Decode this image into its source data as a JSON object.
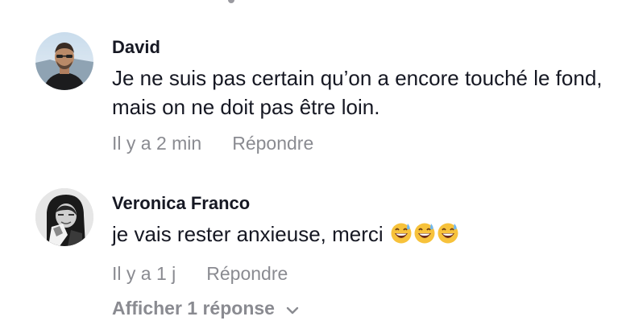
{
  "comments": [
    {
      "author": "David",
      "text": "Je ne suis pas certain qu’on a encore touché le fond, mais on ne doit pas être loin.",
      "time": "Il y a 2 min",
      "reply_label": "Répondre"
    },
    {
      "author": "Veronica Franco",
      "text": "je vais rester anxieuse, merci",
      "emojis": [
        "grinning-sweat-emoji",
        "grinning-sweat-emoji",
        "grinning-sweat-emoji"
      ],
      "time": "Il y a 1 j",
      "reply_label": "Répondre"
    }
  ],
  "view_replies_label": "Afficher 1 réponse",
  "colors": {
    "text": "#161823",
    "muted": "#8a8b91",
    "background": "#ffffff"
  }
}
